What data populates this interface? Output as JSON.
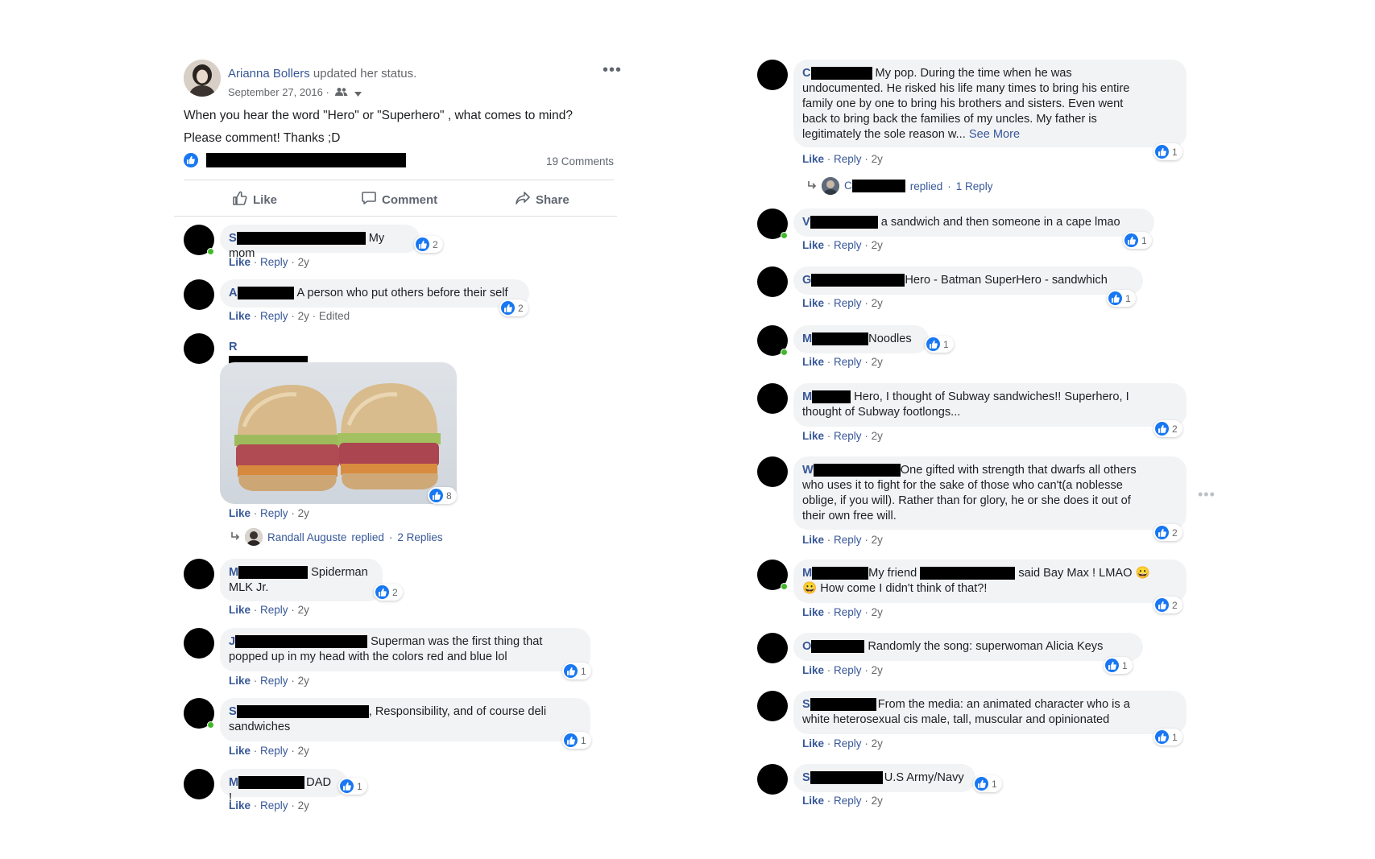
{
  "post": {
    "author": "Arianna Bollers",
    "action": "updated her status.",
    "date": "September 27, 2016",
    "separator": "·",
    "text_line1": "When you hear the word \"Hero\" or \"Superhero\" , what comes to mind?",
    "text_line2": "Please comment! Thanks ;D",
    "comments_count": "19 Comments",
    "actions": {
      "like": "Like",
      "comment": "Comment",
      "share": "Share"
    },
    "icons": [
      "audience-friends-icon",
      "chevron-down-icon",
      "more-options-icon",
      "like-reaction-icon",
      "thumbs-up-icon",
      "comment-icon",
      "share-icon"
    ]
  },
  "labels": {
    "like": "Like",
    "reply": "Reply",
    "dot": "·",
    "time": "2y",
    "edited": "Edited",
    "see_more": "See More"
  },
  "left_comments": [
    {
      "initial": "S",
      "text": "My mom",
      "reactions": "2"
    },
    {
      "initial": "A",
      "text": "A person who put others before their self",
      "reactions": "2"
    },
    {
      "initial": "R",
      "text": "",
      "reactions": "8",
      "attachment": "sandwich-photo",
      "reply_author": "Randall Auguste",
      "reply_action": "replied",
      "reply_count": "2 Replies"
    },
    {
      "initial": "M",
      "text_line1": "Spiderman",
      "text_line2": "MLK Jr.",
      "reactions": "2"
    },
    {
      "initial": "J",
      "text_line1": "Superman was the first thing that",
      "text_line2": "popped up in my head with the colors red and blue lol",
      "reactions": "1"
    },
    {
      "initial": "S",
      "text_line1": ", Responsibility, and of course deli",
      "text_line2": "sandwiches",
      "reactions": "1"
    },
    {
      "initial": "M",
      "text": "DAD !",
      "reactions": "1"
    }
  ],
  "right_comments": [
    {
      "initial": "C",
      "lines": [
        "My pop. During the time when he was",
        "undocumented. He risked his life many times to bring his entire",
        "family one by one to bring his brothers and sisters. Even went",
        "back to bring back the families of my uncles. My father is",
        "legitimately the sole reason w..."
      ],
      "reactions": "1",
      "reply_initial": "C",
      "reply_action": "replied",
      "reply_sep": "·",
      "reply_count": "1 Reply"
    },
    {
      "initial": "V",
      "text": "a sandwich and then someone in a cape lmao",
      "reactions": "1"
    },
    {
      "initial": "G",
      "text": "Hero - Batman SuperHero - sandwhich",
      "reactions": "1"
    },
    {
      "initial": "M",
      "text": "Noodles",
      "reactions": "1"
    },
    {
      "initial": "M",
      "lines": [
        "Hero, I thought of Subway sandwiches!! Superhero, I",
        "thought of Subway footlongs..."
      ],
      "reactions": "2"
    },
    {
      "initial": "W",
      "lines": [
        "One gifted with strength that dwarfs all others",
        "who uses it to fight for the sake of those who can't(a noblesse",
        "oblige, if you will). Rather than for glory, he or she does it out of",
        "their own free will."
      ],
      "reactions": "2"
    },
    {
      "initial": "M",
      "text_a": "My friend",
      "text_b": "said Bay Max ! LMAO",
      "emoji": "😀",
      "text_line2": "How come I didn't think of that?!",
      "reactions": "2"
    },
    {
      "initial": "O",
      "text": "Randomly the song: superwoman Alicia Keys",
      "reactions": "1"
    },
    {
      "initial": "S",
      "lines": [
        "From the media: an animated character who is a",
        "white heterosexual cis male, tall, muscular and opinionated"
      ],
      "reactions": "1"
    },
    {
      "initial": "S",
      "text": "U.S Army/Navy",
      "reactions": "1"
    }
  ]
}
